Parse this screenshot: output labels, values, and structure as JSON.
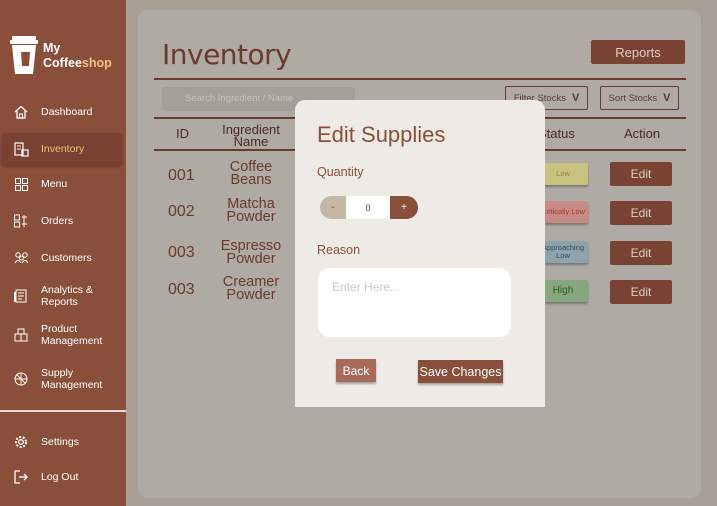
{
  "brand": {
    "line1": "My",
    "line2_a": "Coffee",
    "line2_b": "shop"
  },
  "sidebar": {
    "items": [
      {
        "label": "Dashboard",
        "icon": "home-icon"
      },
      {
        "label": "Inventory",
        "icon": "inventory-icon",
        "active": true
      },
      {
        "label": "Menu",
        "icon": "grid-icon"
      },
      {
        "label": "Orders",
        "icon": "orders-icon"
      },
      {
        "label": "Customers",
        "icon": "customers-icon"
      },
      {
        "label": "Analytics &",
        "label2": "Reports",
        "icon": "analytics-icon"
      },
      {
        "label": "Product",
        "label2": "Management",
        "icon": "product-icon"
      },
      {
        "label": "Supply",
        "label2": "Management",
        "icon": "supply-icon"
      }
    ],
    "footer": [
      {
        "label": "Settings",
        "icon": "gear-icon"
      },
      {
        "label": "Log Out",
        "icon": "logout-icon"
      }
    ]
  },
  "main": {
    "title": "Inventory",
    "reports_label": "Reports",
    "search_placeholder": "Search Ingredient / Name",
    "filter_label": "Filter Stocks",
    "sort_label": "Sort Stocks",
    "columns": {
      "id": "ID",
      "name_1": "Ingredient",
      "name_2": "Name",
      "status": "Status",
      "action": "Action"
    },
    "rows": [
      {
        "id": "001",
        "name_1": "Coffee",
        "name_2": "Beans",
        "status": "Low",
        "status_color": "#c9c27e",
        "status_text_color": "#8a8440",
        "action": "Edit"
      },
      {
        "id": "002",
        "name_1": "Matcha",
        "name_2": "Powder",
        "status": "Critically Low",
        "status_color": "#c98a86",
        "status_text_color": "#9a3a36",
        "action": "Edit"
      },
      {
        "id": "003",
        "name_1": "Espresso",
        "name_2": "Powder",
        "status": "Approaching Low",
        "status_color": "#8ea4ad",
        "status_text_color": "#2e4a56",
        "action": "Edit"
      },
      {
        "id": "003",
        "name_1": "Creamer",
        "name_2": "Powder",
        "status": "High",
        "status_color": "#86a67e",
        "status_text_color": "#2e5a2a",
        "action": "Edit"
      }
    ]
  },
  "modal": {
    "title": "Edit Supplies",
    "quantity_label": "Quantity",
    "minus": "-",
    "quantity_value": "0",
    "plus": "+",
    "reason_label": "Reason",
    "reason_placeholder": "Enter Here...",
    "back_label": "Back",
    "save_label": "Save Changes"
  }
}
